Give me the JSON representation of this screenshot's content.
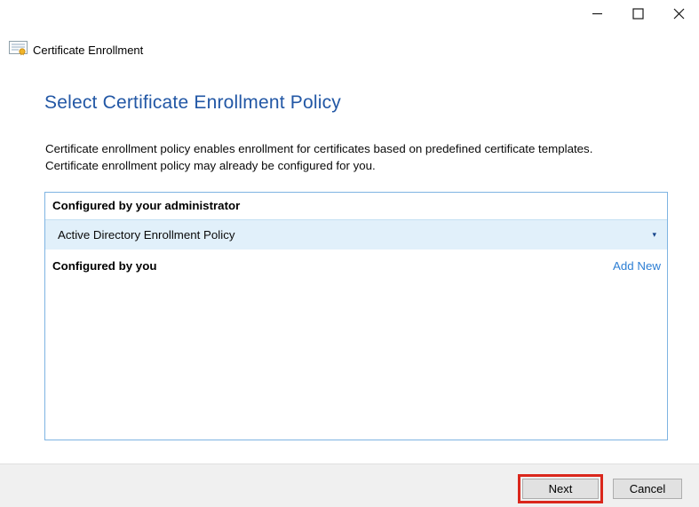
{
  "window": {
    "title": "Certificate Enrollment",
    "controls": {
      "minimize": "minimize",
      "maximize": "maximize",
      "close": "close"
    }
  },
  "heading": "Select Certificate Enrollment Policy",
  "description": {
    "lines": [
      "Certificate enrollment policy enables enrollment for certificates based on predefined certificate templates.",
      "Certificate enrollment policy may already be configured for you."
    ]
  },
  "policy_panel": {
    "admin_section_label": "Configured by your administrator",
    "policy_dropdown": {
      "selected_value": "Active Directory Enrollment Policy",
      "chevron_glyph": "▾"
    },
    "user_section_label": "Configured by you",
    "add_new_label": "Add New"
  },
  "footer": {
    "next_label": "Next",
    "cancel_label": "Cancel"
  },
  "icons": {
    "app_icon": "certificate-icon",
    "dropdown_icon": "chevron-down-icon"
  },
  "colors": {
    "heading_blue": "#2257a5",
    "link_blue": "#2e7fd4",
    "panel_border_blue": "#7eb4e2",
    "dropdown_row_bg": "#e1f0fa",
    "chevron_blue": "#16458c",
    "footer_bg": "#f0f0f0",
    "button_bg": "#e1e1e1",
    "button_border": "#adadad",
    "highlight_red": "#da271c"
  }
}
